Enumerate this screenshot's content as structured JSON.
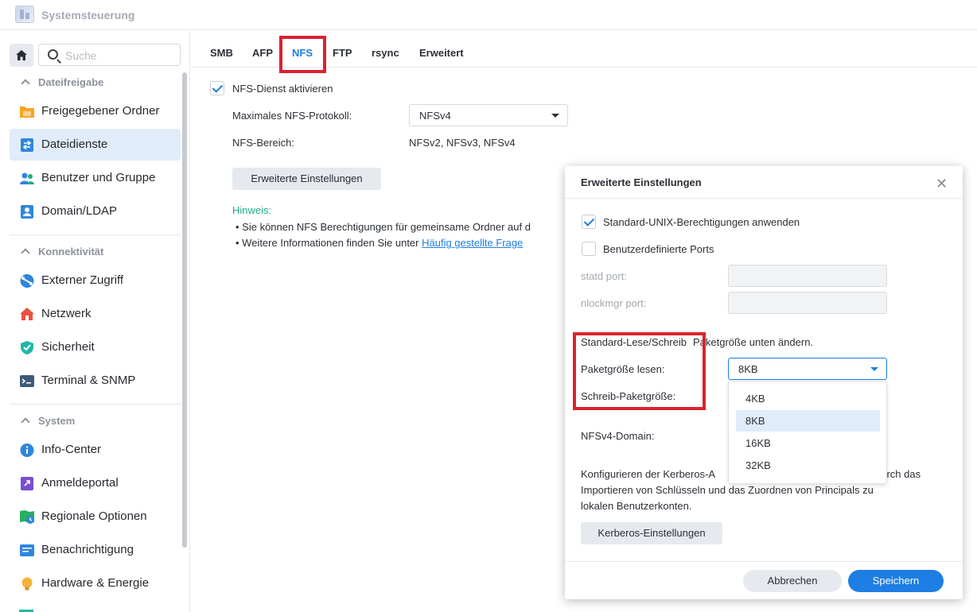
{
  "window": {
    "title": "Systemsteuerung"
  },
  "sidebar": {
    "search_placeholder": "Suche",
    "sections": [
      {
        "label": "Dateifreigabe",
        "items": [
          "Freigegebener Ordner",
          "Dateidienste",
          "Benutzer und Gruppe",
          "Domain/LDAP"
        ]
      },
      {
        "label": "Konnektivität",
        "items": [
          "Externer Zugriff",
          "Netzwerk",
          "Sicherheit",
          "Terminal & SNMP"
        ]
      },
      {
        "label": "System",
        "items": [
          "Info-Center",
          "Anmeldeportal",
          "Regionale Optionen",
          "Benachrichtigung",
          "Hardware & Energie"
        ]
      }
    ],
    "active_item": "Dateidienste"
  },
  "tabs": [
    "SMB",
    "AFP",
    "NFS",
    "FTP",
    "rsync",
    "Erweitert"
  ],
  "active_tab": "NFS",
  "nfs": {
    "enable_label": "NFS-Dienst aktivieren",
    "enable_checked": true,
    "max_protocol_label": "Maximales NFS-Protokoll:",
    "max_protocol_value": "NFSv4",
    "range_label": "NFS-Bereich:",
    "range_value": "NFSv2, NFSv3, NFSv4",
    "advanced_button": "Erweiterte Einstellungen",
    "note_title": "Hinweis:",
    "note_line1": "• Sie können NFS Berechtigungen für gemeinsame Ordner auf d",
    "note_line2_prefix": "• Weitere Informationen finden Sie unter ",
    "note_line2_link": "Häufig gestellte Frage"
  },
  "dialog": {
    "title": "Erweiterte Einstellungen",
    "close_glyph": "✕",
    "unix_perm_label": "Standard-UNIX-Berechtigungen anwenden",
    "unix_perm_checked": true,
    "custom_ports_label": "Benutzerdefinierte Ports",
    "custom_ports_checked": false,
    "statd_label": "statd port:",
    "nlockmgr_label": "nlockmgr port:",
    "rw_text_a": "Standard-Lese/Schreib",
    "rw_text_b": "Paketgröße unten ändern.",
    "read_size_label": "Paketgröße lesen:",
    "read_size_value": "8KB",
    "write_size_label": "Schreib-Paketgröße:",
    "size_options": [
      "4KB",
      "8KB",
      "16KB",
      "32KB"
    ],
    "selected_option": "8KB",
    "nfsv4_domain_label": "NFSv4-Domain:",
    "kerberos_line1_a": "Konfigurieren der Kerberos-A",
    "kerberos_line1_b": "durch das",
    "kerberos_line2": "Importieren von Schlüsseln und das Zuordnen von Principals zu",
    "kerberos_line3": "lokalen Benutzerkonten.",
    "kerberos_button": "Kerberos-Einstellungen",
    "cancel_button": "Abbrechen",
    "save_button": "Speichern"
  },
  "colors": {
    "accent": "#1d7ee3",
    "highlight_red": "#d9232e",
    "note_green": "#1faa8c"
  }
}
